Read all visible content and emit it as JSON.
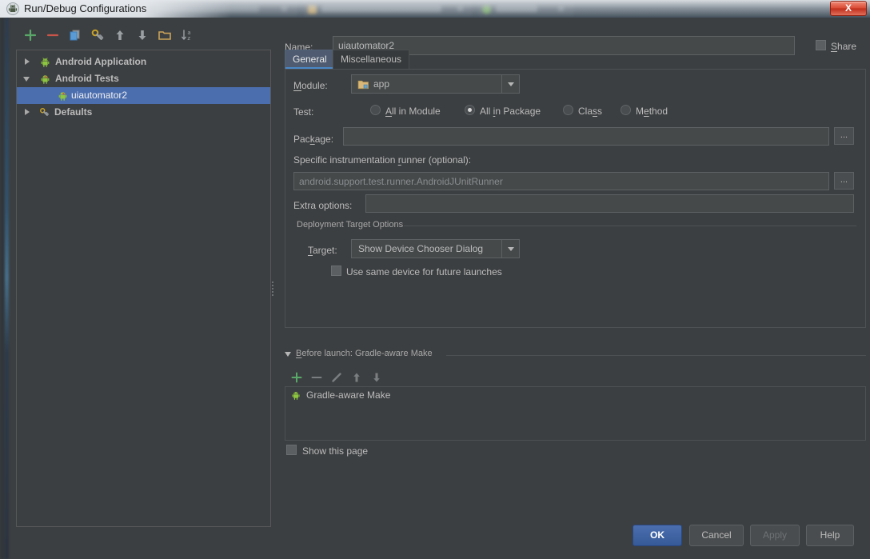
{
  "window": {
    "title": "Run/Debug Configurations",
    "app_icon": "android-bugdroid-icon",
    "close_label": "X"
  },
  "backdrop": {
    "tabs": [
      {
        "name": "editor-tab-1",
        "icon_color": "#b9975b"
      },
      {
        "name": "editor-tab-2",
        "icon_color": "#c9a35a"
      },
      {
        "name": "editor-tab-3",
        "icon_color": "#6aa84f"
      }
    ]
  },
  "left_toolbar": {
    "items": [
      {
        "name": "add-configuration-button",
        "icon": "plus-icon",
        "tooltip": "Add New Configuration"
      },
      {
        "name": "remove-configuration-button",
        "icon": "minus-icon",
        "tooltip": "Remove Configuration"
      },
      {
        "name": "copy-configuration-button",
        "icon": "copy-icon",
        "tooltip": "Copy Configuration"
      },
      {
        "name": "edit-defaults-button",
        "icon": "wrench-key-icon",
        "tooltip": "Edit Defaults"
      },
      {
        "name": "move-up-button",
        "icon": "arrow-up-icon",
        "tooltip": "Move Up"
      },
      {
        "name": "move-down-button",
        "icon": "arrow-down-icon",
        "tooltip": "Move Down"
      },
      {
        "name": "create-folder-button",
        "icon": "folder-icon",
        "tooltip": "Create New Folder"
      },
      {
        "name": "sort-button",
        "icon": "sort-alpha-icon",
        "tooltip": "Sort Configurations"
      }
    ]
  },
  "tree": {
    "nodes": [
      {
        "label": "Android Application",
        "icon": "android-icon",
        "expanded": false,
        "depth": 0,
        "selected": false,
        "bold": true
      },
      {
        "label": "Android Tests",
        "icon": "android-icon",
        "expanded": true,
        "depth": 0,
        "selected": false,
        "bold": true
      },
      {
        "label": "uiautomator2",
        "icon": "android-icon",
        "expanded": null,
        "depth": 1,
        "selected": true,
        "bold": false
      },
      {
        "label": "Defaults",
        "icon": "wrench-key-icon",
        "expanded": false,
        "depth": 0,
        "selected": false,
        "bold": true
      }
    ]
  },
  "header": {
    "name_label": "Name:",
    "name_value": "uiautomator2",
    "share_label": "Share",
    "share_checked": false
  },
  "tabs": [
    {
      "label": "General",
      "active": true
    },
    {
      "label": "Miscellaneous",
      "active": false
    }
  ],
  "general": {
    "module_label": "Module:",
    "module_value": "app",
    "module_icon": "module-folder-icon",
    "test_label": "Test:",
    "test_options": [
      {
        "label": "All in Module",
        "selected": false
      },
      {
        "label": "All in Package",
        "selected": true
      },
      {
        "label": "Class",
        "selected": false
      },
      {
        "label": "Method",
        "selected": false
      }
    ],
    "package_label": "Package:",
    "package_value": "",
    "package_browse": "...",
    "runner_label": "Specific instrumentation runner (optional):",
    "runner_value": "android.support.test.runner.AndroidJUnitRunner",
    "runner_browse": "...",
    "extra_options_label": "Extra options:",
    "extra_options_value": "",
    "deployment_group_title": "Deployment Target Options",
    "target_label": "Target:",
    "target_value": "Show Device Chooser Dialog",
    "same_device_label": "Use same device for future launches",
    "same_device_checked": false
  },
  "before_launch": {
    "group_title": "Before launch: Gradle-aware Make",
    "expanded": true,
    "toolbar": [
      {
        "name": "before-launch-add-button",
        "icon": "plus-icon"
      },
      {
        "name": "before-launch-remove-button",
        "icon": "minus-icon"
      },
      {
        "name": "before-launch-edit-button",
        "icon": "pencil-icon"
      },
      {
        "name": "before-launch-move-up-button",
        "icon": "arrow-up-icon"
      },
      {
        "name": "before-launch-move-down-button",
        "icon": "arrow-down-icon"
      }
    ],
    "items": [
      {
        "label": "Gradle-aware Make",
        "icon": "android-icon"
      }
    ],
    "show_page_label": "Show this page",
    "show_page_checked": false
  },
  "footer": {
    "buttons": [
      {
        "label": "OK",
        "style": "primary",
        "name": "ok-button",
        "enabled": true
      },
      {
        "label": "Cancel",
        "style": "normal",
        "name": "cancel-button",
        "enabled": true
      },
      {
        "label": "Apply",
        "style": "disabled",
        "name": "apply-button",
        "enabled": false
      },
      {
        "label": "Help",
        "style": "normal",
        "name": "help-button",
        "enabled": true
      }
    ]
  },
  "colors": {
    "accent_blue": "#4b6eaf",
    "panel_bg": "#3c3f41",
    "field_bg": "#45494a",
    "text": "#bbbbbb",
    "green": "#4caf50",
    "red": "#cc5c51",
    "orange": "#c9a35a"
  }
}
